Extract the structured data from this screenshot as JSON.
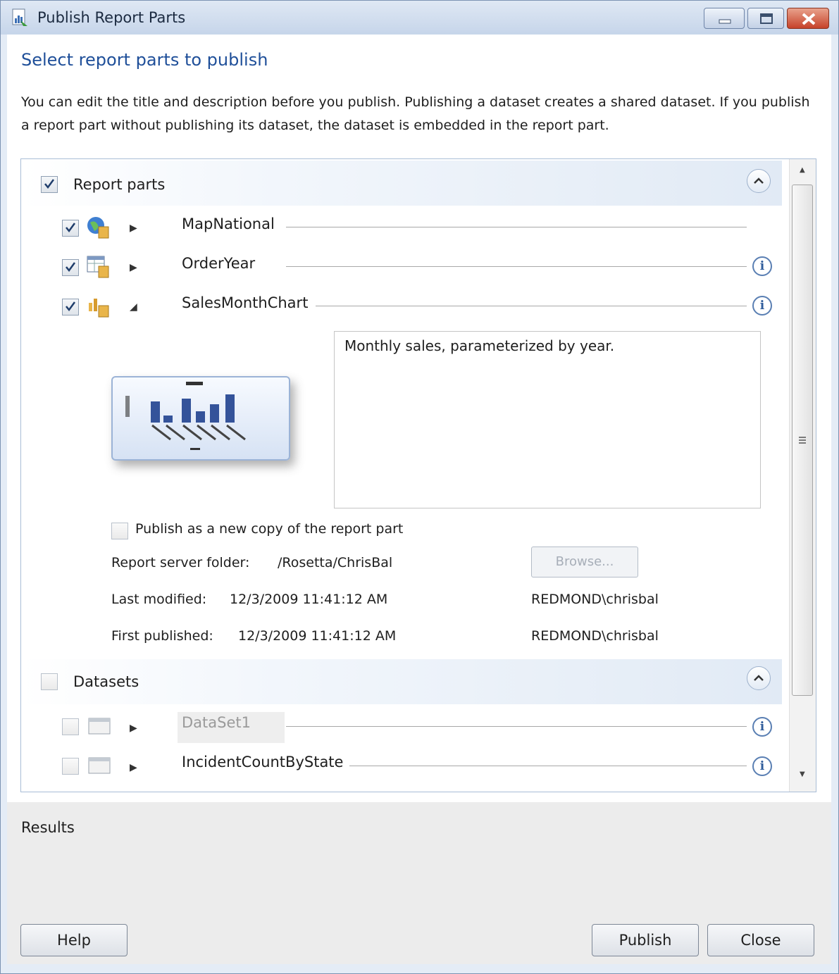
{
  "window": {
    "title": "Publish Report Parts",
    "icons": [
      "app-icon",
      "minimize-icon",
      "maximize-icon",
      "close-icon"
    ]
  },
  "header": {
    "heading": "Select report parts to publish",
    "description": "You can edit the title and description before you publish. Publishing a dataset creates a shared dataset. If you publish a report part without publishing its dataset, the dataset is embedded in the report part."
  },
  "report_parts": {
    "label": "Report parts",
    "checked": true,
    "items": [
      {
        "name": "MapNational",
        "checked": true,
        "icon": "map-icon",
        "expanded": false
      },
      {
        "name": "OrderYear",
        "checked": true,
        "icon": "tablix-icon",
        "expanded": false
      },
      {
        "name": "SalesMonthChart",
        "checked": true,
        "icon": "chart-icon",
        "expanded": true
      }
    ],
    "expanded_item": {
      "description": "Monthly sales, parameterized by year.",
      "publish_new_copy_label": "Publish as a new copy of the report part",
      "publish_new_copy_checked": false,
      "folder_label": "Report server folder:",
      "folder_value": "/Rosetta/ChrisBal",
      "browse_label": "Browse...",
      "last_modified_label": "Last modified:",
      "last_modified_value": "12/3/2009 11:41:12 AM",
      "last_modified_by": "REDMOND\\chrisbal",
      "first_published_label": "First published:",
      "first_published_value": "12/3/2009 11:41:12 AM",
      "first_published_by": "REDMOND\\chrisbal"
    }
  },
  "datasets": {
    "label": "Datasets",
    "checked": false,
    "items": [
      {
        "name": "DataSet1",
        "checked": false,
        "icon": "dataset-icon"
      },
      {
        "name": "IncidentCountByState",
        "checked": false,
        "icon": "dataset-icon"
      }
    ]
  },
  "results": {
    "label": "Results"
  },
  "footer": {
    "help_label": "Help",
    "publish_label": "Publish",
    "close_label": "Close"
  },
  "colors": {
    "heading": "#1f4f99",
    "panel_border": "#a9bdd6",
    "info_icon": "#2f5c9b"
  }
}
